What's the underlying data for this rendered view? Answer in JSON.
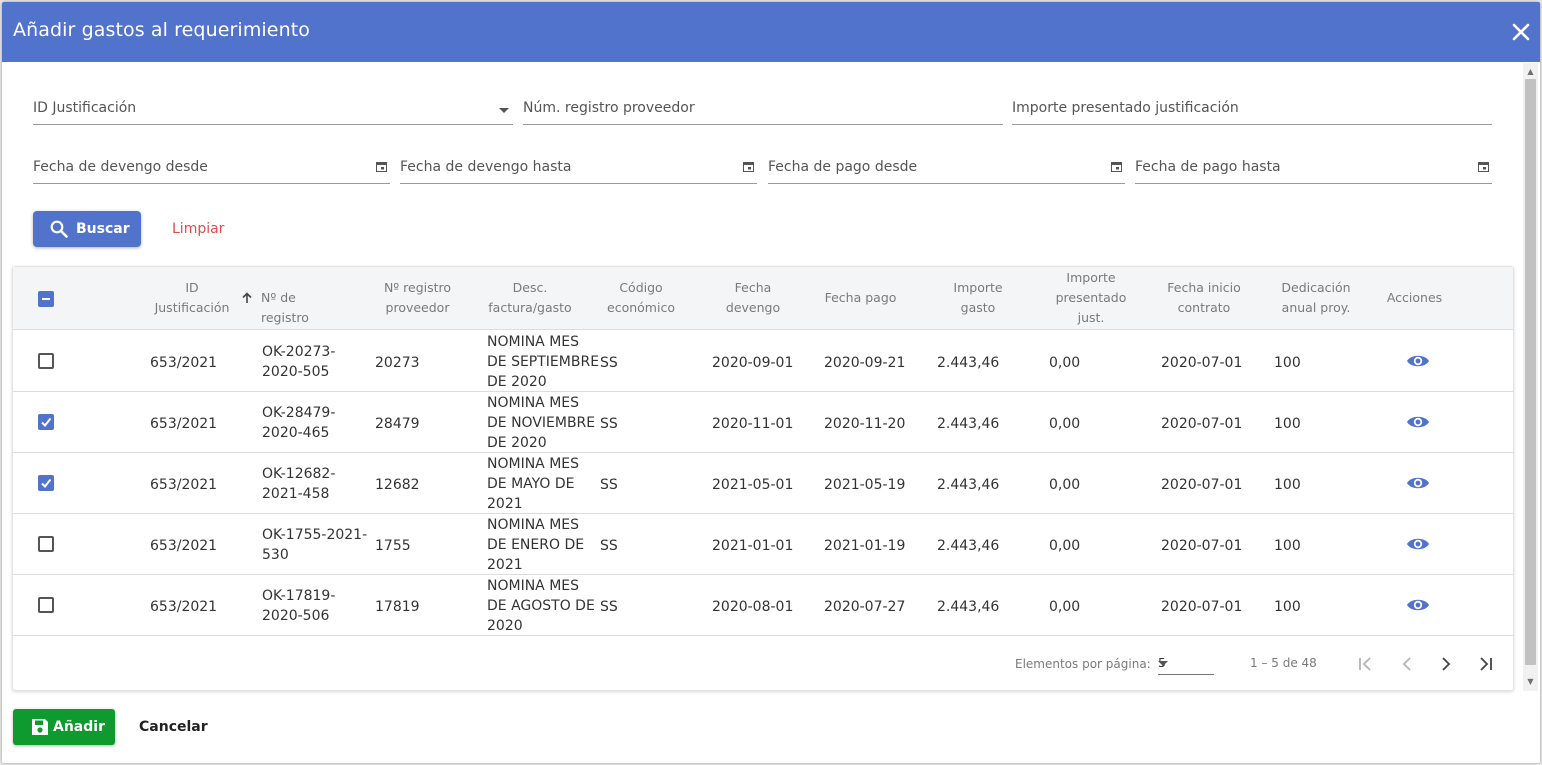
{
  "dialog": {
    "title": "Añadir gastos al requerimiento"
  },
  "filters": {
    "id_justificacion": "ID Justificación",
    "num_registro_proveedor": "Núm. registro proveedor",
    "importe_presentado": "Importe presentado justificación",
    "fecha_devengo_desde": "Fecha de devengo desde",
    "fecha_devengo_hasta": "Fecha de devengo hasta",
    "fecha_pago_desde": "Fecha de pago desde",
    "fecha_pago_hasta": "Fecha de pago hasta"
  },
  "actions": {
    "buscar": "Buscar",
    "limpiar": "Limpiar"
  },
  "table": {
    "headers": {
      "id_justificacion": [
        "ID",
        "Justificación"
      ],
      "n_registro": "Nº de registro",
      "n_registro_proveedor": [
        "Nº registro",
        "proveedor"
      ],
      "desc_factura": [
        "Desc.",
        "factura/gasto"
      ],
      "codigo_economico": [
        "Código",
        "económico"
      ],
      "fecha_devengo": [
        "Fecha",
        "devengo"
      ],
      "fecha_pago": "Fecha pago",
      "importe_gasto": [
        "Importe",
        "gasto"
      ],
      "importe_presentado": [
        "Importe",
        "presentado",
        "just."
      ],
      "fecha_inicio_contrato": [
        "Fecha inicio",
        "contrato"
      ],
      "dedicacion_anual": [
        "Dedicación",
        "anual proy."
      ],
      "acciones": "Acciones"
    },
    "rows": [
      {
        "checked": false,
        "id": "653/2021",
        "registro": [
          "OK-20273-",
          "2020-505"
        ],
        "proveedor": "20273",
        "desc": [
          "NOMINA MES",
          "DE SEPTIEMBRE",
          "DE 2020"
        ],
        "codigo": "SS",
        "devengo": "2020-09-01",
        "pago": "2020-09-21",
        "importe": "2.443,46",
        "presentado": "0,00",
        "inicio": "2020-07-01",
        "dedicacion": "100"
      },
      {
        "checked": true,
        "id": "653/2021",
        "registro": [
          "OK-28479-",
          "2020-465"
        ],
        "proveedor": "28479",
        "desc": [
          "NOMINA MES",
          "DE NOVIEMBRE",
          "DE 2020"
        ],
        "codigo": "SS",
        "devengo": "2020-11-01",
        "pago": "2020-11-20",
        "importe": "2.443,46",
        "presentado": "0,00",
        "inicio": "2020-07-01",
        "dedicacion": "100"
      },
      {
        "checked": true,
        "id": "653/2021",
        "registro": [
          "OK-12682-",
          "2021-458"
        ],
        "proveedor": "12682",
        "desc": [
          "NOMINA MES",
          "DE MAYO DE",
          "2021"
        ],
        "codigo": "SS",
        "devengo": "2021-05-01",
        "pago": "2021-05-19",
        "importe": "2.443,46",
        "presentado": "0,00",
        "inicio": "2020-07-01",
        "dedicacion": "100"
      },
      {
        "checked": false,
        "id": "653/2021",
        "registro": [
          "OK-1755-2021-",
          "530"
        ],
        "proveedor": "1755",
        "desc": [
          "NOMINA MES",
          "DE ENERO DE",
          "2021"
        ],
        "codigo": "SS",
        "devengo": "2021-01-01",
        "pago": "2021-01-19",
        "importe": "2.443,46",
        "presentado": "0,00",
        "inicio": "2020-07-01",
        "dedicacion": "100"
      },
      {
        "checked": false,
        "id": "653/2021",
        "registro": [
          "OK-17819-",
          "2020-506"
        ],
        "proveedor": "17819",
        "desc": [
          "NOMINA MES",
          "DE AGOSTO DE",
          "2020"
        ],
        "codigo": "SS",
        "devengo": "2020-08-01",
        "pago": "2020-07-27",
        "importe": "2.443,46",
        "presentado": "0,00",
        "inicio": "2020-07-01",
        "dedicacion": "100"
      }
    ]
  },
  "paginator": {
    "label": "Elementos por página:",
    "page_size": "5",
    "range": "1 – 5 de 48"
  },
  "footer": {
    "anadir": "Añadir",
    "cancelar": "Cancelar"
  },
  "colors": {
    "primary": "#5273cc",
    "success": "#0f9a2f",
    "danger": "#e04b4b"
  }
}
